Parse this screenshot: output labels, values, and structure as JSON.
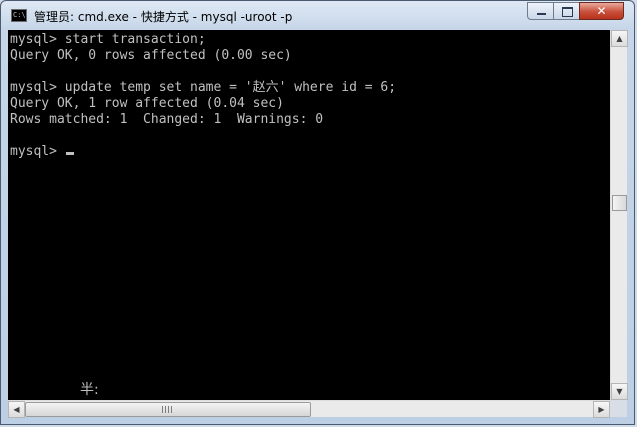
{
  "window": {
    "title": "管理员: cmd.exe - 快捷方式 - mysql  -uroot -p",
    "app_icon_text": "C:\\"
  },
  "controls": {
    "minimize": "minimize",
    "maximize": "maximize",
    "close": "✕"
  },
  "console": {
    "lines": [
      "mysql> start transaction;",
      "Query OK, 0 rows affected (0.00 sec)",
      "",
      "mysql> update temp set name = '赵六' where id = 6;",
      "Query OK, 1 row affected (0.04 sec)",
      "Rows matched: 1  Changed: 1  Warnings: 0",
      "",
      "mysql> "
    ],
    "ime_status": "半:"
  },
  "colors": {
    "console_background": "#000000",
    "console_text": "#c0c0c0"
  }
}
